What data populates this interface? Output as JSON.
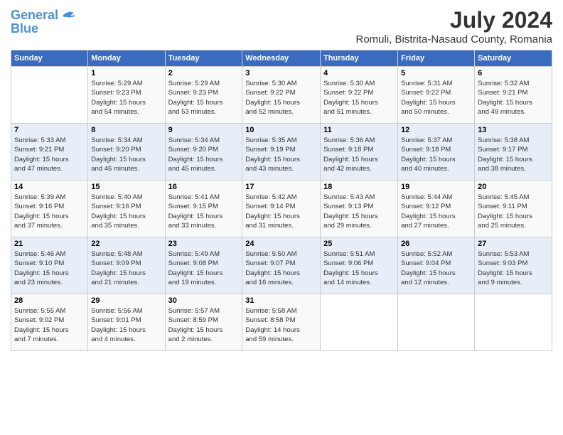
{
  "header": {
    "logo_line1": "General",
    "logo_line2": "Blue",
    "title": "July 2024",
    "subtitle": "Romuli, Bistrita-Nasaud County, Romania"
  },
  "columns": [
    "Sunday",
    "Monday",
    "Tuesday",
    "Wednesday",
    "Thursday",
    "Friday",
    "Saturday"
  ],
  "weeks": [
    {
      "days": [
        {
          "num": "",
          "info": ""
        },
        {
          "num": "1",
          "info": "Sunrise: 5:29 AM\nSunset: 9:23 PM\nDaylight: 15 hours\nand 54 minutes."
        },
        {
          "num": "2",
          "info": "Sunrise: 5:29 AM\nSunset: 9:23 PM\nDaylight: 15 hours\nand 53 minutes."
        },
        {
          "num": "3",
          "info": "Sunrise: 5:30 AM\nSunset: 9:22 PM\nDaylight: 15 hours\nand 52 minutes."
        },
        {
          "num": "4",
          "info": "Sunrise: 5:30 AM\nSunset: 9:22 PM\nDaylight: 15 hours\nand 51 minutes."
        },
        {
          "num": "5",
          "info": "Sunrise: 5:31 AM\nSunset: 9:22 PM\nDaylight: 15 hours\nand 50 minutes."
        },
        {
          "num": "6",
          "info": "Sunrise: 5:32 AM\nSunset: 9:21 PM\nDaylight: 15 hours\nand 49 minutes."
        }
      ]
    },
    {
      "days": [
        {
          "num": "7",
          "info": "Sunrise: 5:33 AM\nSunset: 9:21 PM\nDaylight: 15 hours\nand 47 minutes."
        },
        {
          "num": "8",
          "info": "Sunrise: 5:34 AM\nSunset: 9:20 PM\nDaylight: 15 hours\nand 46 minutes."
        },
        {
          "num": "9",
          "info": "Sunrise: 5:34 AM\nSunset: 9:20 PM\nDaylight: 15 hours\nand 45 minutes."
        },
        {
          "num": "10",
          "info": "Sunrise: 5:35 AM\nSunset: 9:19 PM\nDaylight: 15 hours\nand 43 minutes."
        },
        {
          "num": "11",
          "info": "Sunrise: 5:36 AM\nSunset: 9:18 PM\nDaylight: 15 hours\nand 42 minutes."
        },
        {
          "num": "12",
          "info": "Sunrise: 5:37 AM\nSunset: 9:18 PM\nDaylight: 15 hours\nand 40 minutes."
        },
        {
          "num": "13",
          "info": "Sunrise: 5:38 AM\nSunset: 9:17 PM\nDaylight: 15 hours\nand 38 minutes."
        }
      ]
    },
    {
      "days": [
        {
          "num": "14",
          "info": "Sunrise: 5:39 AM\nSunset: 9:16 PM\nDaylight: 15 hours\nand 37 minutes."
        },
        {
          "num": "15",
          "info": "Sunrise: 5:40 AM\nSunset: 9:16 PM\nDaylight: 15 hours\nand 35 minutes."
        },
        {
          "num": "16",
          "info": "Sunrise: 5:41 AM\nSunset: 9:15 PM\nDaylight: 15 hours\nand 33 minutes."
        },
        {
          "num": "17",
          "info": "Sunrise: 5:42 AM\nSunset: 9:14 PM\nDaylight: 15 hours\nand 31 minutes."
        },
        {
          "num": "18",
          "info": "Sunrise: 5:43 AM\nSunset: 9:13 PM\nDaylight: 15 hours\nand 29 minutes."
        },
        {
          "num": "19",
          "info": "Sunrise: 5:44 AM\nSunset: 9:12 PM\nDaylight: 15 hours\nand 27 minutes."
        },
        {
          "num": "20",
          "info": "Sunrise: 5:45 AM\nSunset: 9:11 PM\nDaylight: 15 hours\nand 25 minutes."
        }
      ]
    },
    {
      "days": [
        {
          "num": "21",
          "info": "Sunrise: 5:46 AM\nSunset: 9:10 PM\nDaylight: 15 hours\nand 23 minutes."
        },
        {
          "num": "22",
          "info": "Sunrise: 5:48 AM\nSunset: 9:09 PM\nDaylight: 15 hours\nand 21 minutes."
        },
        {
          "num": "23",
          "info": "Sunrise: 5:49 AM\nSunset: 9:08 PM\nDaylight: 15 hours\nand 19 minutes."
        },
        {
          "num": "24",
          "info": "Sunrise: 5:50 AM\nSunset: 9:07 PM\nDaylight: 15 hours\nand 16 minutes."
        },
        {
          "num": "25",
          "info": "Sunrise: 5:51 AM\nSunset: 9:06 PM\nDaylight: 15 hours\nand 14 minutes."
        },
        {
          "num": "26",
          "info": "Sunrise: 5:52 AM\nSunset: 9:04 PM\nDaylight: 15 hours\nand 12 minutes."
        },
        {
          "num": "27",
          "info": "Sunrise: 5:53 AM\nSunset: 9:03 PM\nDaylight: 15 hours\nand 9 minutes."
        }
      ]
    },
    {
      "days": [
        {
          "num": "28",
          "info": "Sunrise: 5:55 AM\nSunset: 9:02 PM\nDaylight: 15 hours\nand 7 minutes."
        },
        {
          "num": "29",
          "info": "Sunrise: 5:56 AM\nSunset: 9:01 PM\nDaylight: 15 hours\nand 4 minutes."
        },
        {
          "num": "30",
          "info": "Sunrise: 5:57 AM\nSunset: 8:59 PM\nDaylight: 15 hours\nand 2 minutes."
        },
        {
          "num": "31",
          "info": "Sunrise: 5:58 AM\nSunset: 8:58 PM\nDaylight: 14 hours\nand 59 minutes."
        },
        {
          "num": "",
          "info": ""
        },
        {
          "num": "",
          "info": ""
        },
        {
          "num": "",
          "info": ""
        }
      ]
    }
  ]
}
